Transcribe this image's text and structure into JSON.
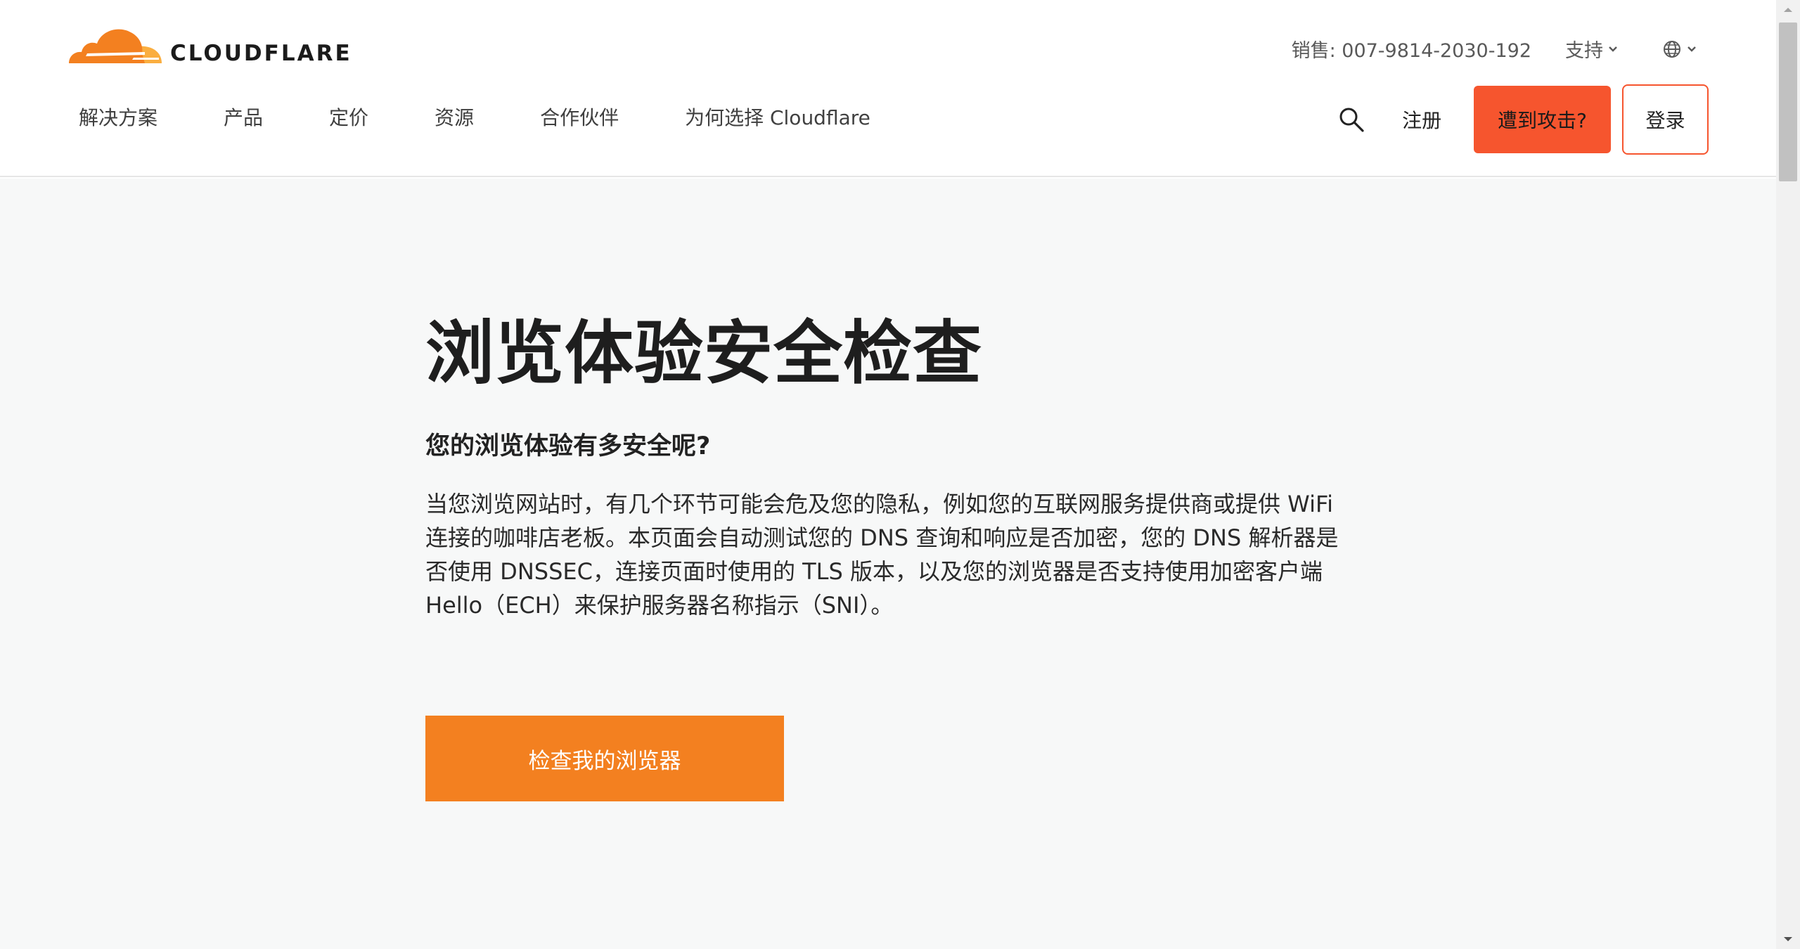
{
  "brand": {
    "name": "CLOUDFLARE",
    "orange": "#f38020",
    "light_orange": "#faae40",
    "attack_red": "#f6552e"
  },
  "utility": {
    "sales": "销售: 007-9814-2030-192",
    "support": "支持",
    "language_icon": "globe-icon"
  },
  "nav": {
    "items": [
      {
        "label": "解决方案"
      },
      {
        "label": "产品"
      },
      {
        "label": "定价"
      },
      {
        "label": "资源"
      },
      {
        "label": "合作伙伴"
      },
      {
        "label": "为何选择 Cloudflare"
      }
    ]
  },
  "actions": {
    "search_icon": "search-icon",
    "signup": "注册",
    "under_attack": "遭到攻击?",
    "login": "登录"
  },
  "main": {
    "title": "浏览体验安全检查",
    "subtitle": "您的浏览体验有多安全呢?",
    "description": "当您浏览网站时，有几个环节可能会危及您的隐私，例如您的互联网服务提供商或提供 WiFi 连接的咖啡店老板。本页面会自动测试您的 DNS 查询和响应是否加密，您的 DNS 解析器是否使用 DNSSEC，连接页面时使用的 TLS 版本，以及您的浏览器是否支持使用加密客户端 Hello（ECH）来保护服务器名称指示（SNI）。",
    "check_button": "检查我的浏览器"
  }
}
